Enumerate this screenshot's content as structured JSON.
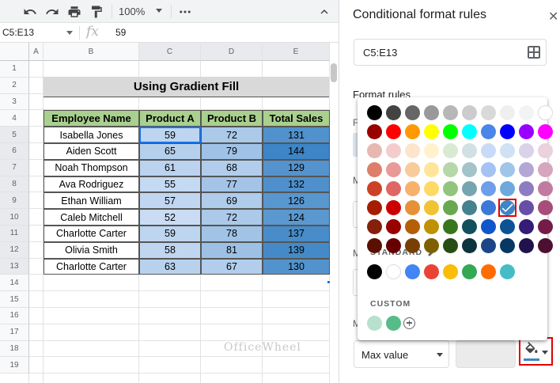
{
  "toolbar": {
    "zoom_value": "100%",
    "icons": [
      "undo-icon",
      "redo-icon",
      "print-icon",
      "paint-format-icon",
      "zoom-dropdown",
      "more-icon",
      "collapse-icon"
    ]
  },
  "formula_bar": {
    "name_box": "C5:E13",
    "fx_label": "fx",
    "value": "59"
  },
  "sheet": {
    "columns": [
      "A",
      "B",
      "C",
      "D",
      "E"
    ],
    "rows": [
      "1",
      "2",
      "3",
      "4",
      "5",
      "6",
      "7",
      "8",
      "9",
      "10",
      "11",
      "12",
      "13",
      "14",
      "15",
      "16",
      "17",
      "18",
      "19"
    ],
    "title": "Using Gradient Fill",
    "headers": [
      "Employee Name",
      "Product A",
      "Product B",
      "Total Sales"
    ],
    "data": [
      [
        "Isabella Jones",
        "59",
        "72",
        "131"
      ],
      [
        "Aiden Scott",
        "65",
        "79",
        "144"
      ],
      [
        "Noah Thompson",
        "61",
        "68",
        "129"
      ],
      [
        "Ava Rodriguez",
        "55",
        "77",
        "132"
      ],
      [
        "Ethan William",
        "57",
        "69",
        "126"
      ],
      [
        "Caleb Mitchell",
        "52",
        "72",
        "124"
      ],
      [
        "Charlotte Carter",
        "59",
        "78",
        "137"
      ],
      [
        "Olivia Smith",
        "58",
        "81",
        "139"
      ],
      [
        "Charlotte Carter",
        "63",
        "67",
        "130"
      ]
    ],
    "header_color": "#a9d08e",
    "gradient_min_color": "#c9dcf3",
    "gradient_max_color": "#3d85c6"
  },
  "panel": {
    "title": "Conditional format rules",
    "close_icon": "close-icon",
    "range": "C5:E13",
    "format_rules_label": "Format rules",
    "peek_labels": [
      "F",
      "M",
      "M",
      "M"
    ],
    "max_value_select": "Max value",
    "fill_color_icon": "fill-color-icon"
  },
  "picker": {
    "palette": [
      [
        "#000000",
        "#434343",
        "#666666",
        "#999999",
        "#b7b7b7",
        "#cccccc",
        "#d9d9d9",
        "#efefef",
        "#f3f3f3",
        "#ffffff"
      ],
      [
        "#980000",
        "#ff0000",
        "#ff9900",
        "#ffff00",
        "#00ff00",
        "#00ffff",
        "#4a86e8",
        "#0000ff",
        "#9900ff",
        "#ff00ff"
      ],
      [
        "#e6b8af",
        "#f4cccc",
        "#fce5cd",
        "#fff2cc",
        "#d9ead3",
        "#d0e0e3",
        "#c9daf8",
        "#cfe2f3",
        "#d9d2e9",
        "#ead1dc"
      ],
      [
        "#dd7e6b",
        "#ea9999",
        "#f9cb9c",
        "#ffe599",
        "#b6d7a8",
        "#a2c4c9",
        "#a4c2f4",
        "#9fc5e8",
        "#b4a7d6",
        "#d5a6bd"
      ],
      [
        "#cc4125",
        "#e06666",
        "#f6b26b",
        "#ffd966",
        "#93c47d",
        "#76a5af",
        "#6d9eeb",
        "#6fa8dc",
        "#8e7cc3",
        "#c27ba0"
      ],
      [
        "#a61c00",
        "#cc0000",
        "#e69138",
        "#f1c232",
        "#6aa84f",
        "#45818e",
        "#3c78d8",
        "#3d85c6",
        "#674ea7",
        "#a64d79"
      ],
      [
        "#85200c",
        "#990000",
        "#b45f06",
        "#bf9000",
        "#38761d",
        "#134f5c",
        "#1155cc",
        "#0b5394",
        "#351c75",
        "#741b47"
      ],
      [
        "#5b0f00",
        "#660000",
        "#783f04",
        "#7f6000",
        "#274e13",
        "#0c343d",
        "#1c4587",
        "#073763",
        "#20124d",
        "#4c1130"
      ]
    ],
    "selected": "#3d85c6",
    "standard_label": "STANDARD",
    "standard_colors": [
      "#000000",
      "#ffffff",
      "#4285f4",
      "#ea4335",
      "#fbbc04",
      "#34a853",
      "#ff6d01",
      "#46bdc6"
    ],
    "custom_label": "CUSTOM",
    "custom_colors": [
      "#b7e1cd",
      "#57bb8a"
    ],
    "edit_icon": "pencil-icon",
    "add_icon": "add-custom-color-icon"
  },
  "watermark": "OfficeWheel"
}
